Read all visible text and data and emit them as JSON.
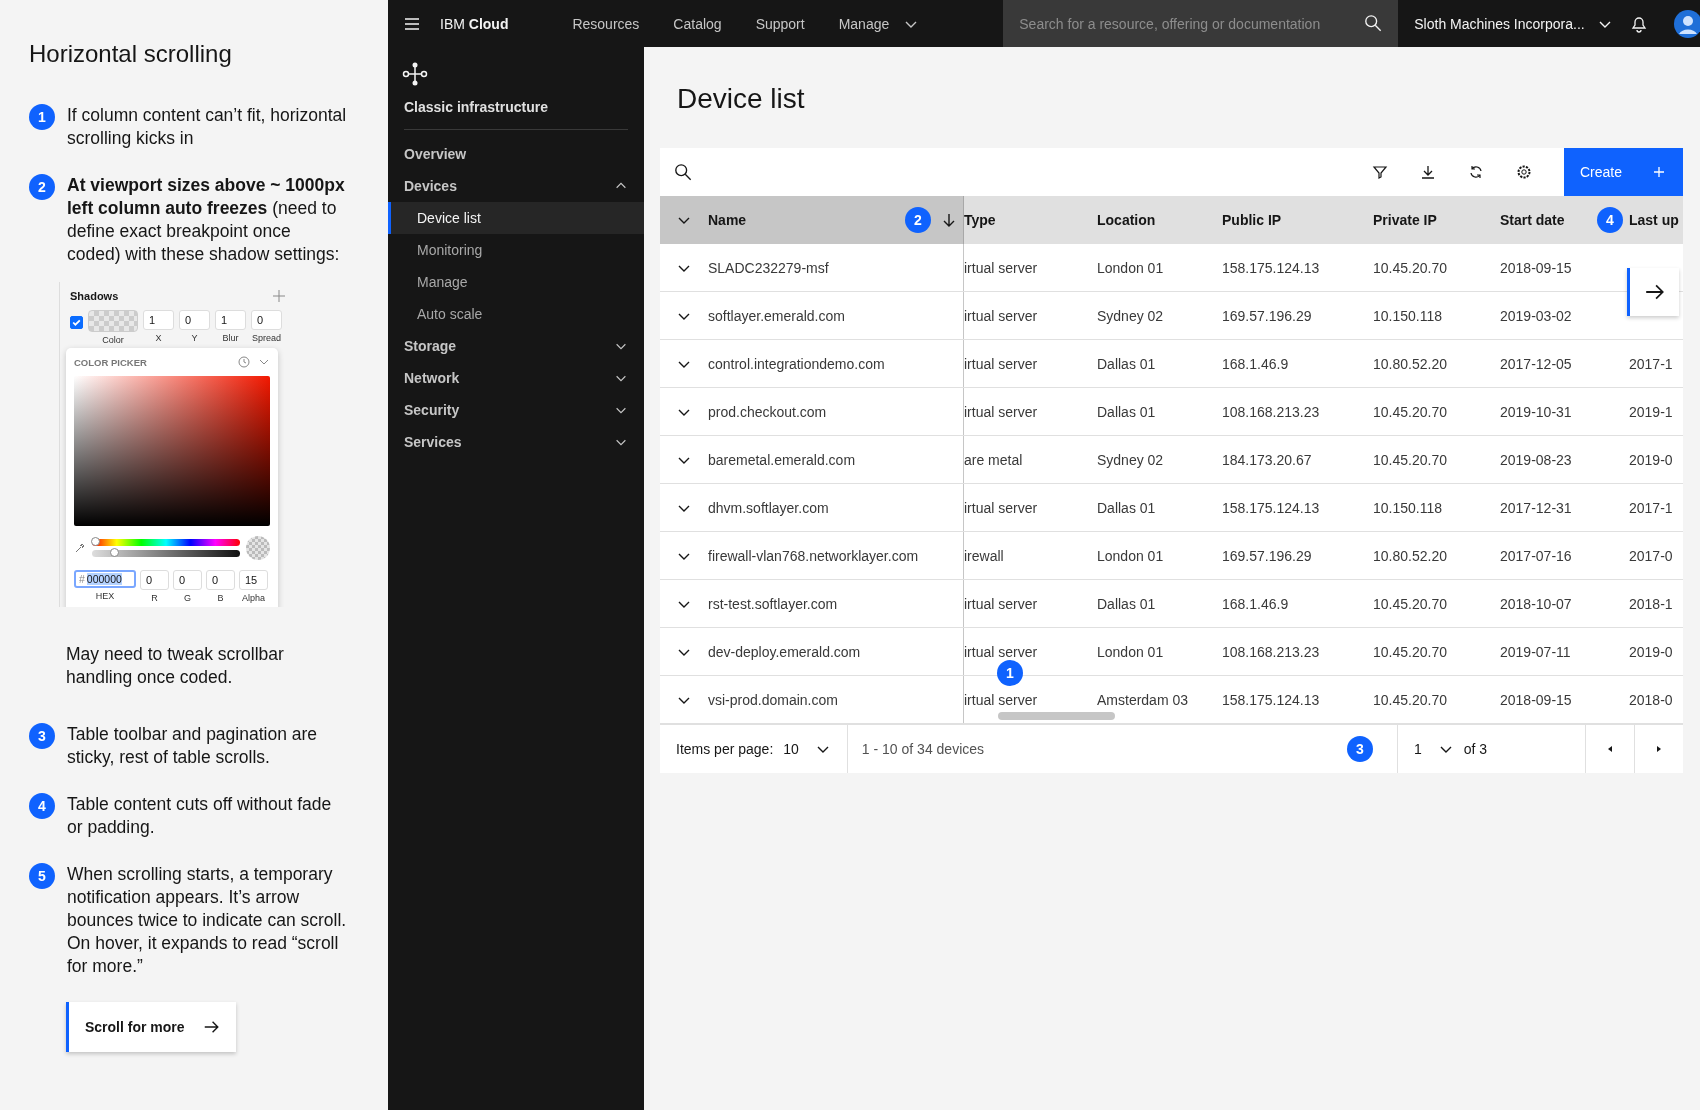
{
  "guide": {
    "title": "Horizontal scrolling",
    "blocks": [
      {
        "kind": "note",
        "number": "1",
        "text": "If column content can’t fit, horizontal scrolling kicks in"
      },
      {
        "kind": "note",
        "number": "2",
        "text": "**At viewport sizes above ~ 1000px left column auto freezes** (need to define exact breakpoint once coded) with these shadow settings:"
      },
      {
        "kind": "figure"
      },
      {
        "kind": "plain",
        "text": "May need to tweak scrollbar handling once coded."
      },
      {
        "kind": "note",
        "number": "3",
        "text": "Table toolbar and pagination are sticky, rest of table scrolls."
      },
      {
        "kind": "note",
        "number": "4",
        "text": "Table content cuts off without fade or padding."
      },
      {
        "kind": "note",
        "number": "5",
        "text": "When scrolling starts, a temporary notification appears. It’s arrow bounces twice to indicate can scroll. On hover, it expands to read “scroll for more.”"
      }
    ],
    "shadows": {
      "title": "Shadows",
      "checked": true,
      "fields": [
        {
          "label": "Color",
          "kind": "swatch"
        },
        {
          "label": "X",
          "value": "1",
          "kind": "number"
        },
        {
          "label": "Y",
          "value": "0",
          "kind": "number"
        },
        {
          "label": "Blur",
          "value": "1",
          "kind": "number"
        },
        {
          "label": "Spread",
          "value": "0",
          "kind": "number"
        }
      ]
    },
    "picker": {
      "title": "COLOR PICKER",
      "sliders": [
        {
          "kind": "hue",
          "level": 0.02
        },
        {
          "kind": "alpha",
          "level": 0.15
        }
      ],
      "hex_prefix": "#",
      "hex": "000000",
      "hex_label": "HEX",
      "channels": [
        {
          "label": "R",
          "value": "0"
        },
        {
          "label": "G",
          "value": "0"
        },
        {
          "label": "B",
          "value": "0"
        },
        {
          "label": "Alpha",
          "value": "15"
        }
      ]
    },
    "scroll_button": {
      "label": "Scroll for more"
    }
  },
  "header": {
    "brand": "IBM **Cloud**",
    "nav": [
      {
        "label": "Resources",
        "dropdown": false
      },
      {
        "label": "Catalog",
        "dropdown": false
      },
      {
        "label": "Support",
        "dropdown": false
      },
      {
        "label": "Manage",
        "dropdown": true
      }
    ],
    "search": {
      "placeholder": "Search for a resource, offering or documentation"
    },
    "account": "Sloth Machines Incorpora..."
  },
  "sidebar": {
    "title": "Classic infrastructure",
    "items": [
      {
        "label": "Overview",
        "kind": "link"
      },
      {
        "label": "Devices",
        "kind": "section",
        "expanded": true,
        "children": [
          {
            "label": "Device list",
            "selected": true
          },
          {
            "label": "Monitoring",
            "selected": false
          },
          {
            "label": "Manage",
            "selected": false
          },
          {
            "label": "Auto scale",
            "selected": false
          }
        ]
      },
      {
        "label": "Storage",
        "kind": "section",
        "expanded": false
      },
      {
        "label": "Network",
        "kind": "section",
        "expanded": false
      },
      {
        "label": "Security",
        "kind": "section",
        "expanded": false
      },
      {
        "label": "Services",
        "kind": "section",
        "expanded": false
      }
    ]
  },
  "page_title": "Device list",
  "table": {
    "create_button": "Create",
    "scroll_marker": "1",
    "columns": [
      {
        "label": "Name",
        "sorted": true,
        "marker": "2"
      },
      {
        "label": "Type",
        "sorted": false
      },
      {
        "label": "Location",
        "sorted": false
      },
      {
        "label": "Public IP",
        "sorted": false
      },
      {
        "label": "Private IP",
        "sorted": false
      },
      {
        "label": "Start date",
        "sorted": false
      },
      {
        "label": "Last up",
        "sorted": false,
        "marker": "4"
      }
    ],
    "rows": [
      [
        "SLADC232279-msf",
        "irtual server",
        "London 01",
        "158.175.124.13",
        "10.45.20.70",
        "2018-09-15"
      ],
      [
        "softlayer.emerald.com",
        "irtual server",
        "Sydney 02",
        "169.57.196.29",
        "10.150.118",
        "2019-03-02"
      ],
      [
        "control.integrationdemo.com",
        "irtual server",
        "Dallas 01",
        "168.1.46.9",
        "10.80.52.20",
        "2017-12-05",
        "2017-1"
      ],
      [
        "prod.checkout.com",
        "irtual server",
        "Dallas 01",
        "108.168.213.23",
        "10.45.20.70",
        "2019-10-31",
        "2019-1"
      ],
      [
        "baremetal.emerald.com",
        "are metal",
        "Sydney 02",
        "184.173.20.67",
        "10.45.20.70",
        "2019-08-23",
        "2019-0"
      ],
      [
        "dhvm.softlayer.com",
        "irtual server",
        "Dallas 01",
        "158.175.124.13",
        "10.150.118",
        "2017-12-31",
        "2017-1"
      ],
      [
        "firewall-vlan768.networklayer.com",
        "irewall",
        "London 01",
        "169.57.196.29",
        "10.80.52.20",
        "2017-07-16",
        "2017-0"
      ],
      [
        "rst-test.softlayer.com",
        "irtual server",
        "Dallas 01",
        "168.1.46.9",
        "10.45.20.70",
        "2018-10-07",
        "2018-1"
      ],
      [
        "dev-deploy.emerald.com",
        "irtual server",
        "London 01",
        "108.168.213.23",
        "10.45.20.70",
        "2019-07-11",
        "2019-0"
      ],
      [
        "vsi-prod.domain.com",
        "irtual server",
        "Amsterdam 03",
        "158.175.124.13",
        "10.45.20.70",
        "2018-09-15",
        "2018-0"
      ]
    ],
    "pagination": {
      "items_label": "Items per page:",
      "items_value": "10",
      "range": "1 - 10 of 34 devices",
      "marker": "3",
      "page": "1",
      "page_total": "of 3"
    }
  }
}
